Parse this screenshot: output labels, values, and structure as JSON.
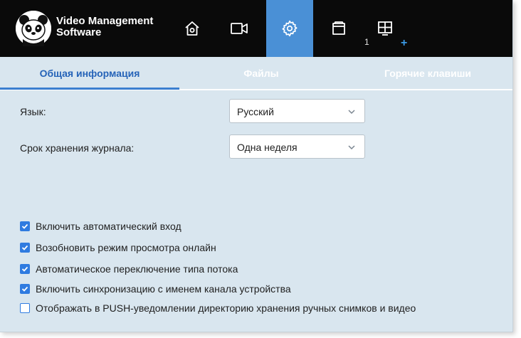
{
  "app": {
    "title_line1": "Video Management",
    "title_line2": "Software"
  },
  "nav": {
    "items": [
      {
        "name": "home",
        "icon": "home-icon"
      },
      {
        "name": "camera",
        "icon": "camera-icon"
      },
      {
        "name": "settings",
        "icon": "gear-icon",
        "active": true
      },
      {
        "name": "storage",
        "icon": "storage-box-icon"
      },
      {
        "name": "layout",
        "icon": "grid-layout-icon"
      }
    ],
    "layout_count": "1",
    "layout_add": "+"
  },
  "tabs": [
    {
      "label": "Общая информация",
      "active": true
    },
    {
      "label": "Файлы",
      "active": false
    },
    {
      "label": "Горячие клавиши",
      "active": false
    }
  ],
  "form": {
    "language_label": "Язык:",
    "language_value": "Русский",
    "log_label": "Срок хранения журнала:",
    "log_value": "Одна неделя"
  },
  "checkboxes": [
    {
      "label": "Включить автоматический вход",
      "checked": true
    },
    {
      "label": "Возобновить режим просмотра онлайн",
      "checked": true
    },
    {
      "label": "Автоматическое переключение типа потока",
      "checked": true
    },
    {
      "label": "Включить синхронизацию с именем канала устройства",
      "checked": true
    },
    {
      "label": "Отображать в PUSH-уведомлении директорию хранения ручных снимков и видео",
      "checked": false
    }
  ],
  "colors": {
    "accent": "#4a90d6",
    "checkbox": "#2f7be0",
    "panel": "#d9e6ef",
    "topbar": "#0a0a0a"
  }
}
